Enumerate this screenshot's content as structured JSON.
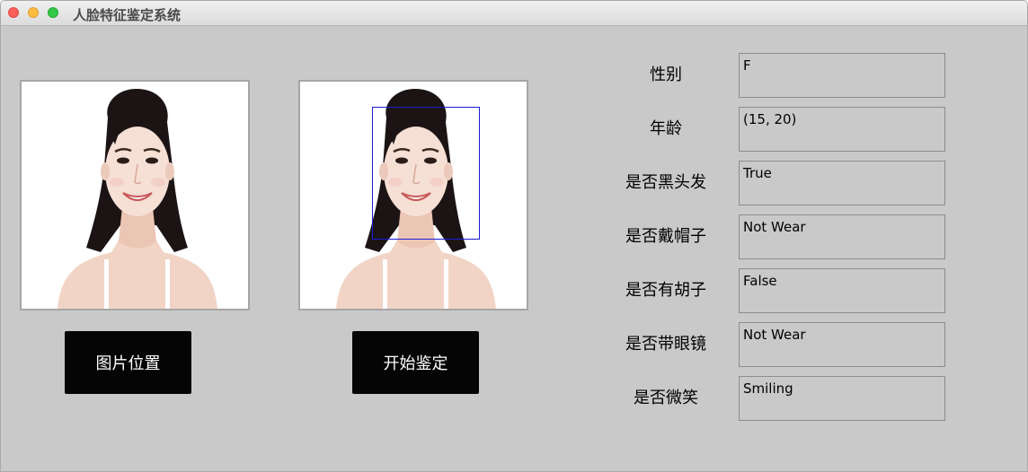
{
  "window": {
    "title": "人脸特征鉴定系统"
  },
  "buttons": {
    "pick_image": "图片位置",
    "start_detection": "开始鉴定"
  },
  "attributes": [
    {
      "label": "性别",
      "value": "F"
    },
    {
      "label": "年龄",
      "value": "(15, 20)"
    },
    {
      "label": "是否黑头发",
      "value": "True"
    },
    {
      "label": "是否戴帽子",
      "value": "Not Wear"
    },
    {
      "label": "是否有胡子",
      "value": "False"
    },
    {
      "label": "是否带眼镜",
      "value": "Not Wear"
    },
    {
      "label": "是否微笑",
      "value": "Smiling"
    }
  ],
  "colors": {
    "background": "#c9c9c9",
    "button": "#050505",
    "face_box": "#1a1ad6"
  }
}
